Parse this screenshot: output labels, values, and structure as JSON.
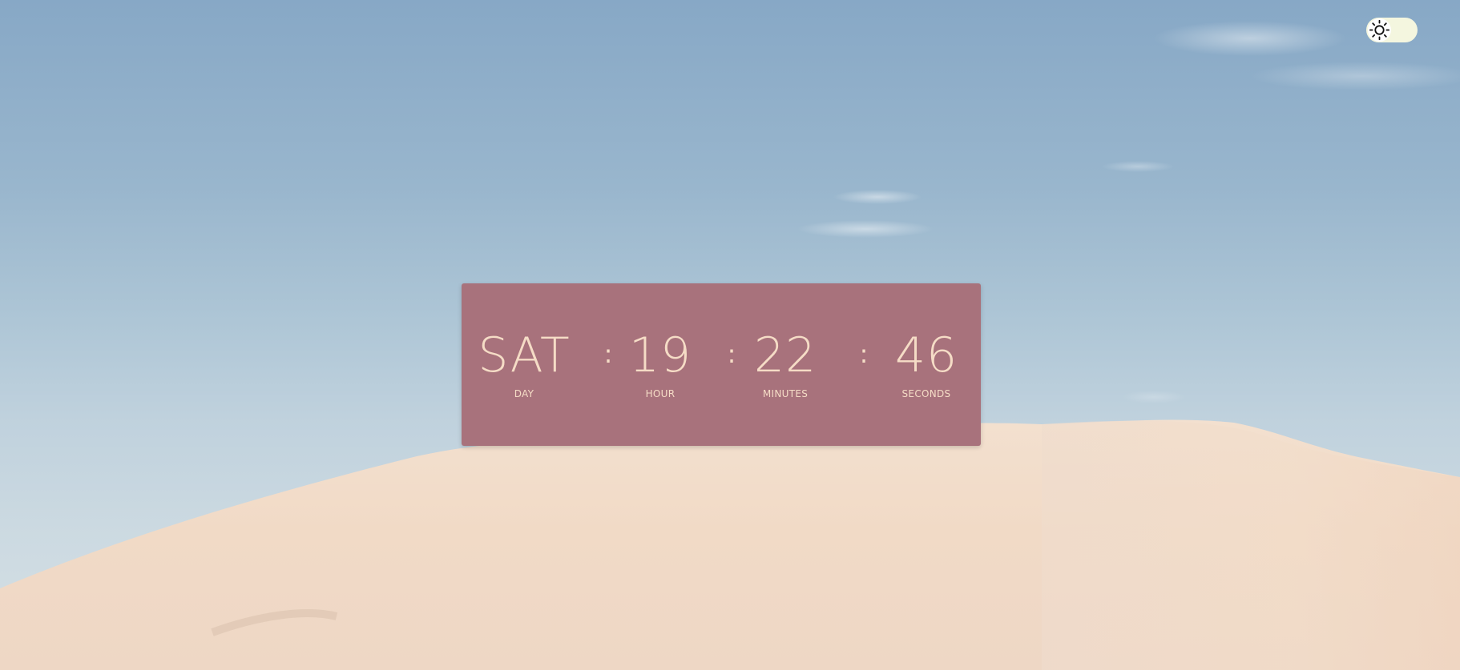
{
  "clock": {
    "day": {
      "value": "SAT",
      "label": "DAY"
    },
    "hour": {
      "value": "19",
      "label": "HOUR"
    },
    "minutes": {
      "value": "22",
      "label": "MINUTES"
    },
    "seconds": {
      "value": "46",
      "label": "SECONDS"
    },
    "separator": ":"
  },
  "theme_toggle": {
    "icon": "sun-icon",
    "mode": "light"
  },
  "colors": {
    "card": "#a8727c",
    "digits": "#f5dcc6",
    "toggle_track": "#f4f6df",
    "sky_top": "#87a8c6",
    "sand": "#f0d9c6"
  }
}
